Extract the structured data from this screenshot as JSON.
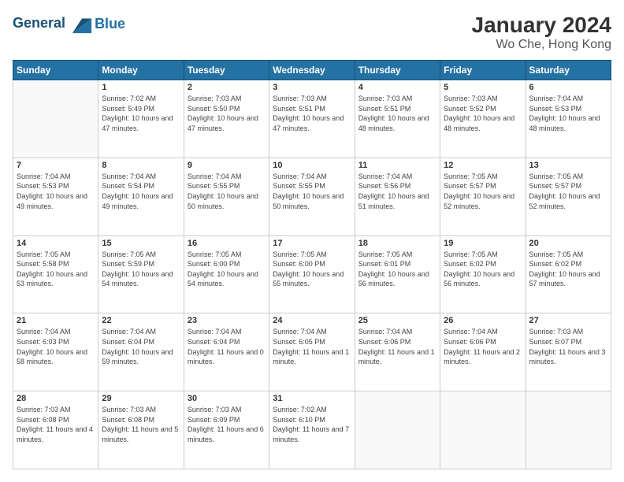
{
  "logo": {
    "line1": "General",
    "line2": "Blue"
  },
  "title": "January 2024",
  "subtitle": "Wo Che, Hong Kong",
  "days_header": [
    "Sunday",
    "Monday",
    "Tuesday",
    "Wednesday",
    "Thursday",
    "Friday",
    "Saturday"
  ],
  "weeks": [
    [
      {
        "day": "",
        "sunrise": "",
        "sunset": "",
        "daylight": ""
      },
      {
        "day": "1",
        "sunrise": "Sunrise: 7:02 AM",
        "sunset": "Sunset: 5:49 PM",
        "daylight": "Daylight: 10 hours and 47 minutes."
      },
      {
        "day": "2",
        "sunrise": "Sunrise: 7:03 AM",
        "sunset": "Sunset: 5:50 PM",
        "daylight": "Daylight: 10 hours and 47 minutes."
      },
      {
        "day": "3",
        "sunrise": "Sunrise: 7:03 AM",
        "sunset": "Sunset: 5:51 PM",
        "daylight": "Daylight: 10 hours and 47 minutes."
      },
      {
        "day": "4",
        "sunrise": "Sunrise: 7:03 AM",
        "sunset": "Sunset: 5:51 PM",
        "daylight": "Daylight: 10 hours and 48 minutes."
      },
      {
        "day": "5",
        "sunrise": "Sunrise: 7:03 AM",
        "sunset": "Sunset: 5:52 PM",
        "daylight": "Daylight: 10 hours and 48 minutes."
      },
      {
        "day": "6",
        "sunrise": "Sunrise: 7:04 AM",
        "sunset": "Sunset: 5:53 PM",
        "daylight": "Daylight: 10 hours and 48 minutes."
      }
    ],
    [
      {
        "day": "7",
        "sunrise": "Sunrise: 7:04 AM",
        "sunset": "Sunset: 5:53 PM",
        "daylight": "Daylight: 10 hours and 49 minutes."
      },
      {
        "day": "8",
        "sunrise": "Sunrise: 7:04 AM",
        "sunset": "Sunset: 5:54 PM",
        "daylight": "Daylight: 10 hours and 49 minutes."
      },
      {
        "day": "9",
        "sunrise": "Sunrise: 7:04 AM",
        "sunset": "Sunset: 5:55 PM",
        "daylight": "Daylight: 10 hours and 50 minutes."
      },
      {
        "day": "10",
        "sunrise": "Sunrise: 7:04 AM",
        "sunset": "Sunset: 5:55 PM",
        "daylight": "Daylight: 10 hours and 50 minutes."
      },
      {
        "day": "11",
        "sunrise": "Sunrise: 7:04 AM",
        "sunset": "Sunset: 5:56 PM",
        "daylight": "Daylight: 10 hours and 51 minutes."
      },
      {
        "day": "12",
        "sunrise": "Sunrise: 7:05 AM",
        "sunset": "Sunset: 5:57 PM",
        "daylight": "Daylight: 10 hours and 52 minutes."
      },
      {
        "day": "13",
        "sunrise": "Sunrise: 7:05 AM",
        "sunset": "Sunset: 5:57 PM",
        "daylight": "Daylight: 10 hours and 52 minutes."
      }
    ],
    [
      {
        "day": "14",
        "sunrise": "Sunrise: 7:05 AM",
        "sunset": "Sunset: 5:58 PM",
        "daylight": "Daylight: 10 hours and 53 minutes."
      },
      {
        "day": "15",
        "sunrise": "Sunrise: 7:05 AM",
        "sunset": "Sunset: 5:59 PM",
        "daylight": "Daylight: 10 hours and 54 minutes."
      },
      {
        "day": "16",
        "sunrise": "Sunrise: 7:05 AM",
        "sunset": "Sunset: 6:00 PM",
        "daylight": "Daylight: 10 hours and 54 minutes."
      },
      {
        "day": "17",
        "sunrise": "Sunrise: 7:05 AM",
        "sunset": "Sunset: 6:00 PM",
        "daylight": "Daylight: 10 hours and 55 minutes."
      },
      {
        "day": "18",
        "sunrise": "Sunrise: 7:05 AM",
        "sunset": "Sunset: 6:01 PM",
        "daylight": "Daylight: 10 hours and 56 minutes."
      },
      {
        "day": "19",
        "sunrise": "Sunrise: 7:05 AM",
        "sunset": "Sunset: 6:02 PM",
        "daylight": "Daylight: 10 hours and 56 minutes."
      },
      {
        "day": "20",
        "sunrise": "Sunrise: 7:05 AM",
        "sunset": "Sunset: 6:02 PM",
        "daylight": "Daylight: 10 hours and 57 minutes."
      }
    ],
    [
      {
        "day": "21",
        "sunrise": "Sunrise: 7:04 AM",
        "sunset": "Sunset: 6:03 PM",
        "daylight": "Daylight: 10 hours and 58 minutes."
      },
      {
        "day": "22",
        "sunrise": "Sunrise: 7:04 AM",
        "sunset": "Sunset: 6:04 PM",
        "daylight": "Daylight: 10 hours and 59 minutes."
      },
      {
        "day": "23",
        "sunrise": "Sunrise: 7:04 AM",
        "sunset": "Sunset: 6:04 PM",
        "daylight": "Daylight: 11 hours and 0 minutes."
      },
      {
        "day": "24",
        "sunrise": "Sunrise: 7:04 AM",
        "sunset": "Sunset: 6:05 PM",
        "daylight": "Daylight: 11 hours and 1 minute."
      },
      {
        "day": "25",
        "sunrise": "Sunrise: 7:04 AM",
        "sunset": "Sunset: 6:06 PM",
        "daylight": "Daylight: 11 hours and 1 minute."
      },
      {
        "day": "26",
        "sunrise": "Sunrise: 7:04 AM",
        "sunset": "Sunset: 6:06 PM",
        "daylight": "Daylight: 11 hours and 2 minutes."
      },
      {
        "day": "27",
        "sunrise": "Sunrise: 7:03 AM",
        "sunset": "Sunset: 6:07 PM",
        "daylight": "Daylight: 11 hours and 3 minutes."
      }
    ],
    [
      {
        "day": "28",
        "sunrise": "Sunrise: 7:03 AM",
        "sunset": "Sunset: 6:08 PM",
        "daylight": "Daylight: 11 hours and 4 minutes."
      },
      {
        "day": "29",
        "sunrise": "Sunrise: 7:03 AM",
        "sunset": "Sunset: 6:08 PM",
        "daylight": "Daylight: 11 hours and 5 minutes."
      },
      {
        "day": "30",
        "sunrise": "Sunrise: 7:03 AM",
        "sunset": "Sunset: 6:09 PM",
        "daylight": "Daylight: 11 hours and 6 minutes."
      },
      {
        "day": "31",
        "sunrise": "Sunrise: 7:02 AM",
        "sunset": "Sunset: 6:10 PM",
        "daylight": "Daylight: 11 hours and 7 minutes."
      },
      {
        "day": "",
        "sunrise": "",
        "sunset": "",
        "daylight": ""
      },
      {
        "day": "",
        "sunrise": "",
        "sunset": "",
        "daylight": ""
      },
      {
        "day": "",
        "sunrise": "",
        "sunset": "",
        "daylight": ""
      }
    ]
  ]
}
